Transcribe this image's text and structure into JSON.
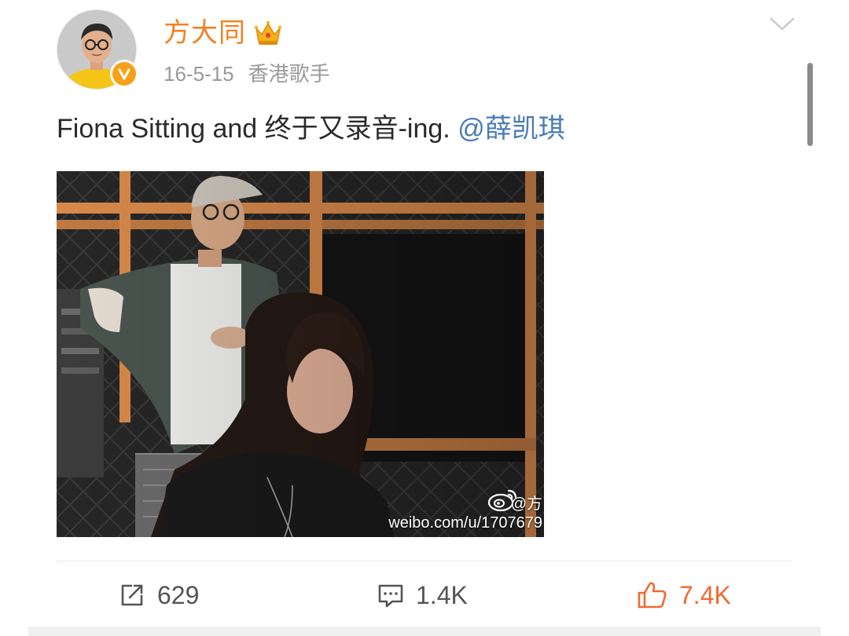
{
  "post": {
    "author": {
      "name": "方大同",
      "avatar": "avatar-photo",
      "verified": true,
      "badge": "crown-icon",
      "colors": {
        "name": "#f2821f",
        "verified": "#f7a11a"
      }
    },
    "meta": {
      "date": "16-5-15",
      "description": "香港歌手"
    },
    "text": {
      "body": "Fiona Sitting and 终于又录音-ing. ",
      "mention": "@薛凯琪",
      "mention_color": "#4a7bb5"
    },
    "image": {
      "watermark_handle": "@方",
      "watermark_url": "weibo.com/u/1707679"
    },
    "actions": {
      "repost": {
        "icon": "repost-icon",
        "count": "629"
      },
      "comment": {
        "icon": "comment-icon",
        "count": "1.4K"
      },
      "like": {
        "icon": "thumbs-up-icon",
        "count": "7.4K",
        "color": "#f06a2f"
      }
    }
  }
}
